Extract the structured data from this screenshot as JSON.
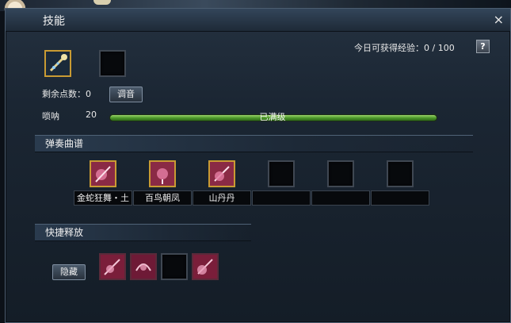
{
  "window": {
    "title": "技能",
    "close_glyph": "×"
  },
  "header": {
    "daily_exp_label": "今日可获得经验",
    "daily_exp_value": "0 / 100",
    "help_glyph": "?"
  },
  "points": {
    "label": "剩余点数",
    "value": "0",
    "tune_button": "调音"
  },
  "suona": {
    "name": "唢呐",
    "level": "20",
    "progress": 1.0,
    "progress_text": "已满级"
  },
  "scores_section": {
    "title": "弹奏曲谱",
    "items": [
      {
        "name": "金蛇狂舞・土",
        "icon": "music-score-icon"
      },
      {
        "name": "百鸟朝凤",
        "icon": "music-score-icon"
      },
      {
        "name": "山丹丹",
        "icon": "music-score-icon"
      },
      {
        "name": "",
        "icon": ""
      },
      {
        "name": "",
        "icon": ""
      },
      {
        "name": "",
        "icon": ""
      }
    ]
  },
  "quick_section": {
    "title": "快捷释放",
    "hide_button": "隐藏"
  },
  "colors": {
    "accent_gold": "#c99b33",
    "bar_green": "#4f9a2c"
  }
}
